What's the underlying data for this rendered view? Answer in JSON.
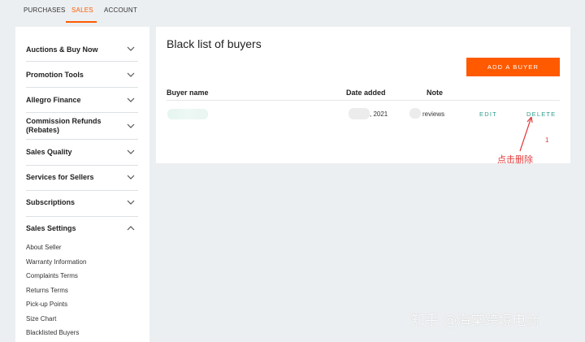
{
  "tabs": [
    {
      "label": "PURCHASES",
      "active": false
    },
    {
      "label": "SALES",
      "active": true
    },
    {
      "label": "ACCOUNT",
      "active": false
    }
  ],
  "sidebar": {
    "sections": [
      {
        "label": "Auctions & Buy Now",
        "expanded": false
      },
      {
        "label": "Promotion Tools",
        "expanded": false
      },
      {
        "label": "Allegro Finance",
        "expanded": false
      },
      {
        "label": "Commission Refunds (Rebates)",
        "expanded": false
      },
      {
        "label": "Sales Quality",
        "expanded": false
      },
      {
        "label": "Services for Sellers",
        "expanded": false
      },
      {
        "label": "Subscriptions",
        "expanded": false
      },
      {
        "label": "Sales Settings",
        "expanded": true
      }
    ],
    "sub_items": [
      "About Seller",
      "Warranty Information",
      "Complaints Terms",
      "Returns Terms",
      "Pick-up Points",
      "Size Chart",
      "Blacklisted Buyers"
    ]
  },
  "main": {
    "title": "Black list of buyers",
    "add_button": "ADD A BUYER",
    "columns": {
      "buyer": "Buyer name",
      "date": "Date added",
      "note": "Note"
    },
    "rows": [
      {
        "buyer": "",
        "date": ", 2021",
        "note": "reviews",
        "edit": "EDIT",
        "delete": "DELETE"
      }
    ]
  },
  "annotation": {
    "number": "1",
    "text": "点击删除"
  },
  "watermark": "知乎 @海棠跨境电商",
  "colors": {
    "accent": "#ff5a00",
    "link": "#2f9d8a",
    "annotation": "#e03c3c"
  }
}
